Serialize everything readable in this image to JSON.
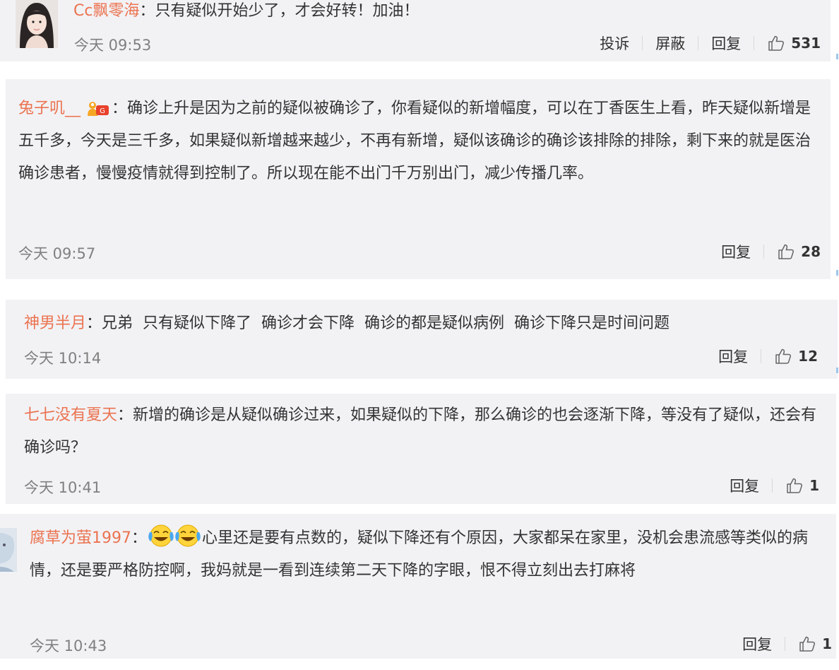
{
  "comments": [
    {
      "username": "Cc飘零海",
      "colon": "：",
      "text": "只有疑似开始少了，才会好转！加油！",
      "time": "今天 09:53",
      "actions": {
        "report": "投诉",
        "block": "屏蔽",
        "reply": "回复"
      },
      "likes": "531"
    },
    {
      "username": "兔子叽__",
      "colon": "：",
      "text": "确诊上升是因为之前的疑似被确诊了，你看疑似的新增幅度，可以在丁香医生上看，昨天疑似新增是五千多，今天是三千多，如果疑似新增越来越少，不再有新增，疑似该确诊的确诊该排除的排除，剩下来的就是医治确诊患者，慢慢疫情就得到控制了。所以现在能不出门千万别出门，减少传播几率。",
      "time": "今天 09:57",
      "actions": {
        "reply": "回复"
      },
      "likes": "28"
    },
    {
      "username": "神男半月",
      "colon": "：",
      "text": "兄弟  只有疑似下降了  确诊才会下降  确诊的都是疑似病例  确诊下降只是时间问题",
      "time": "今天 10:14",
      "actions": {
        "reply": "回复"
      },
      "likes": "12"
    },
    {
      "username": "七七没有夏天",
      "colon": "：",
      "text": "新增的确诊是从疑似确诊过来，如果疑似的下降，那么确诊的也会逐渐下降，等没有了疑似，还会有确诊吗？",
      "time": "今天 10:41",
      "actions": {
        "reply": "回复"
      },
      "likes": "1"
    },
    {
      "username": "腐草为萤1997",
      "colon": "：",
      "text": "心里还是要有点数的，疑似下降还有个原因，大家都呆在家里，没机会患流感等类似的病情，还是要严格防控啊，我妈就是一看到连续第二天下降的字眼，恨不得立刻出去打麻将",
      "time": "今天 10:43",
      "actions": {
        "reply": "回复"
      },
      "likes": "1"
    }
  ],
  "colors": {
    "username": "#eb7350",
    "text": "#333333",
    "time": "#808080",
    "card_bg": "#f2f2f5"
  },
  "icons": {
    "like": "thumbs-up-outline-icon",
    "vip": "vip-crown-badge-icon",
    "emoji": "laughing-crying-emoji-icon"
  }
}
